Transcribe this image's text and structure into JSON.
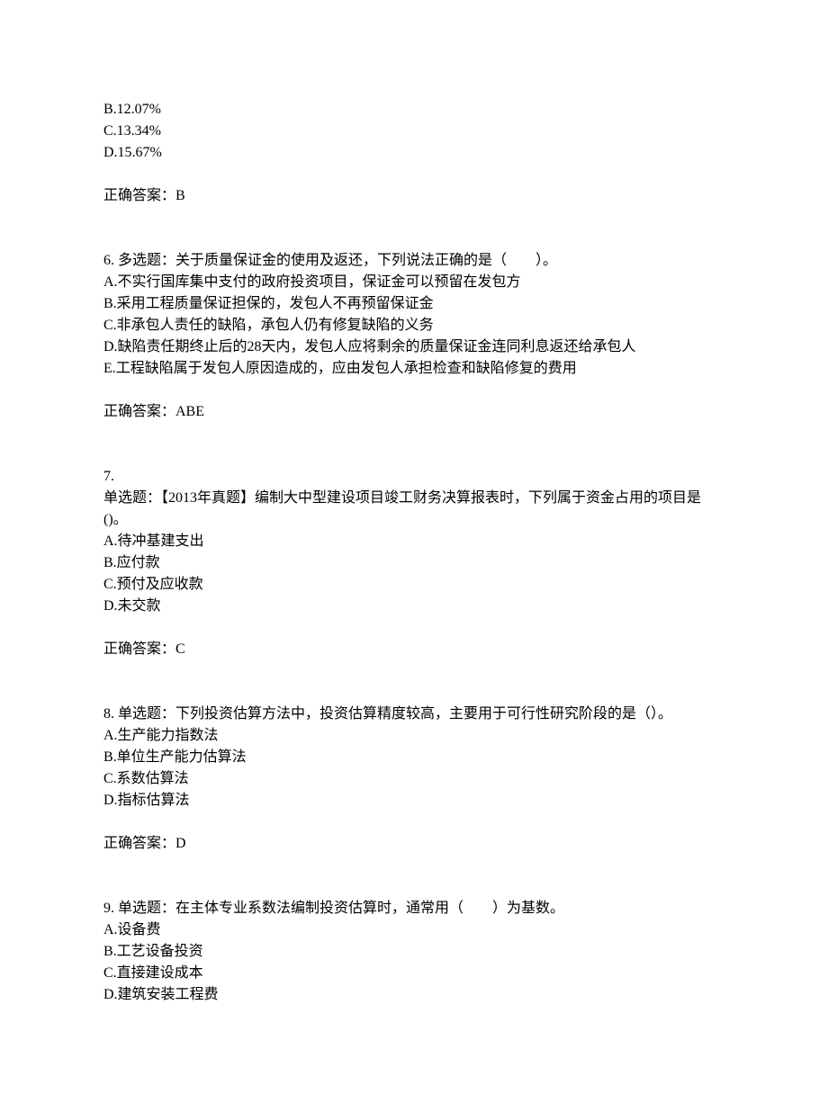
{
  "q5_partial": {
    "options": {
      "B": "B.12.07%",
      "C": "C.13.34%",
      "D": "D.15.67%"
    },
    "answer": "正确答案：B"
  },
  "q6": {
    "stem": "6. 多选题：关于质量保证金的使用及返还，下列说法正确的是（　　）。",
    "options": {
      "A": "A.不实行国库集中支付的政府投资项目，保证金可以预留在发包方",
      "B": "B.采用工程质量保证担保的，发包人不再预留保证金",
      "C": "C.非承包人责任的缺陷，承包人仍有修复缺陷的义务",
      "D": "D.缺陷责任期终止后的28天内，发包人应将剩余的质量保证金连同利息返还给承包人",
      "E": "E.工程缺陷属于发包人原因造成的，应由发包人承担检查和缺陷修复的费用"
    },
    "answer": "正确答案：ABE"
  },
  "q7": {
    "num": "7.",
    "stem": "单选题：【2013年真题】编制大中型建设项目竣工财务决算报表时，下列属于资金占用的项目是()。",
    "options": {
      "A": "A.待冲基建支出",
      "B": "B.应付款",
      "C": "C.预付及应收款",
      "D": "D.未交款"
    },
    "answer": "正确答案：C"
  },
  "q8": {
    "stem": "8. 单选题：下列投资估算方法中，投资估算精度较高，主要用于可行性研究阶段的是（）。",
    "options": {
      "A": "A.生产能力指数法",
      "B": "B.单位生产能力估算法",
      "C": "C.系数估算法",
      "D": "D.指标估算法"
    },
    "answer": "正确答案：D"
  },
  "q9": {
    "stem": "9. 单选题：在主体专业系数法编制投资估算时，通常用（　　）为基数。",
    "options": {
      "A": "A.设备费",
      "B": "B.工艺设备投资",
      "C": "C.直接建设成本",
      "D": "D.建筑安装工程费"
    }
  }
}
